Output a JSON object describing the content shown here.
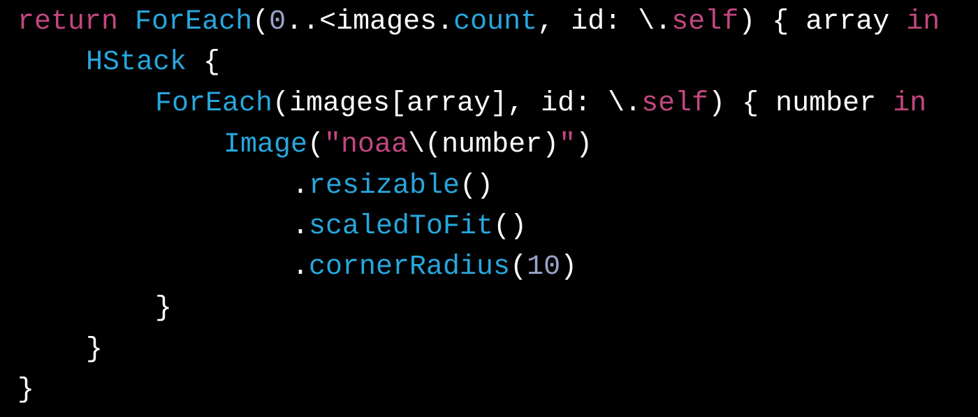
{
  "code": {
    "lines": [
      [
        {
          "t": "return",
          "k": "keyword"
        },
        {
          "t": " ",
          "k": "plain"
        },
        {
          "t": "ForEach",
          "k": "type"
        },
        {
          "t": "(",
          "k": "plain"
        },
        {
          "t": "0",
          "k": "number"
        },
        {
          "t": "..<images.",
          "k": "plain"
        },
        {
          "t": "count",
          "k": "type"
        },
        {
          "t": ", id: \\.",
          "k": "plain"
        },
        {
          "t": "self",
          "k": "keyword"
        },
        {
          "t": ") { array ",
          "k": "plain"
        },
        {
          "t": "in",
          "k": "keyword"
        }
      ],
      [
        {
          "t": "HStack",
          "k": "type"
        },
        {
          "t": " {",
          "k": "plain"
        }
      ],
      [
        {
          "t": "ForEach",
          "k": "type"
        },
        {
          "t": "(images[array], id: \\.",
          "k": "plain"
        },
        {
          "t": "self",
          "k": "keyword"
        },
        {
          "t": ") { number ",
          "k": "plain"
        },
        {
          "t": "in",
          "k": "keyword"
        }
      ],
      [
        {
          "t": "Image",
          "k": "type"
        },
        {
          "t": "(",
          "k": "plain"
        },
        {
          "t": "\"noaa",
          "k": "string"
        },
        {
          "t": "\\(number)",
          "k": "plain"
        },
        {
          "t": "\"",
          "k": "string"
        },
        {
          "t": ")",
          "k": "plain"
        }
      ],
      [
        {
          "t": ".",
          "k": "plain"
        },
        {
          "t": "resizable",
          "k": "type"
        },
        {
          "t": "()",
          "k": "plain"
        }
      ],
      [
        {
          "t": ".",
          "k": "plain"
        },
        {
          "t": "scaledToFit",
          "k": "type"
        },
        {
          "t": "()",
          "k": "plain"
        }
      ],
      [
        {
          "t": ".",
          "k": "plain"
        },
        {
          "t": "cornerRadius",
          "k": "type"
        },
        {
          "t": "(",
          "k": "plain"
        },
        {
          "t": "10",
          "k": "number"
        },
        {
          "t": ")",
          "k": "plain"
        }
      ],
      [
        {
          "t": "}",
          "k": "plain"
        }
      ],
      [
        {
          "t": "}",
          "k": "plain"
        }
      ],
      [
        {
          "t": "}",
          "k": "plain"
        }
      ]
    ]
  },
  "colors": {
    "background": "#000000",
    "keyword": "#c2477f",
    "type": "#27a7dd",
    "plain": "#ffffff",
    "string": "#c2477f",
    "number": "#9aa3c8"
  }
}
